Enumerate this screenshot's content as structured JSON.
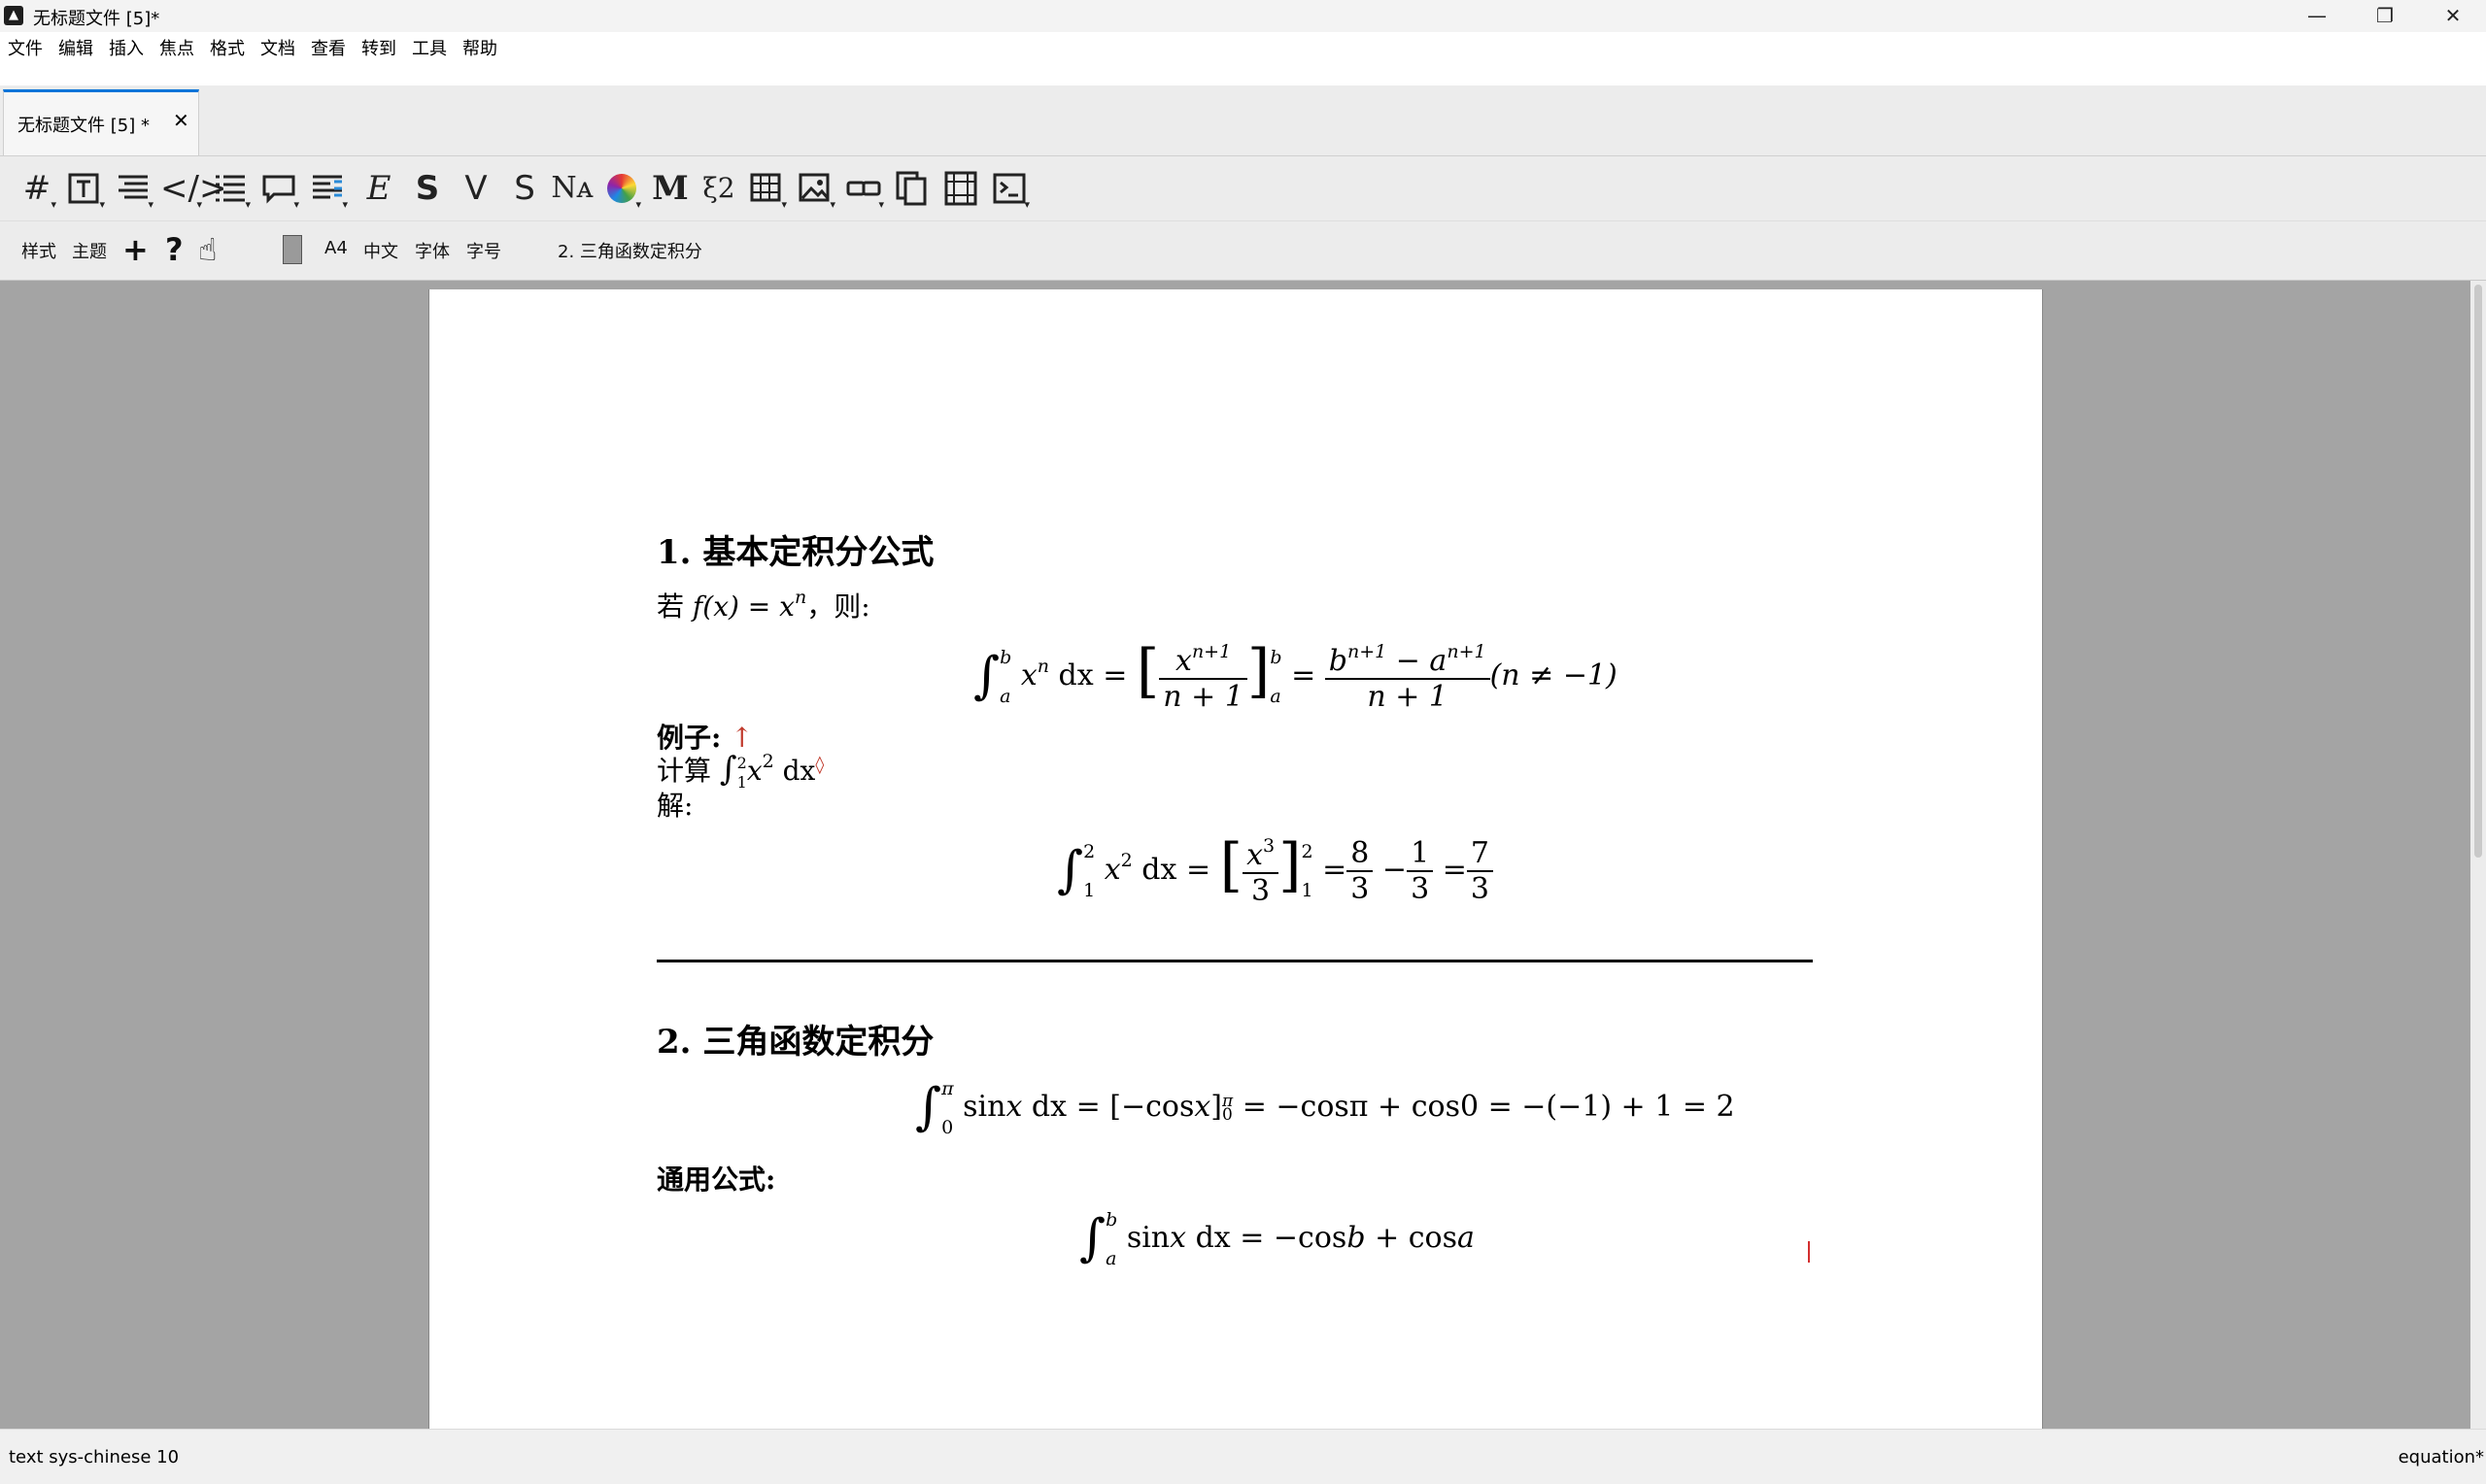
{
  "window": {
    "title": "无标题文件 [5]*",
    "controls": {
      "minimize": "—",
      "restore": "❐",
      "close": "✕"
    }
  },
  "menubar": [
    "文件",
    "编辑",
    "插入",
    "焦点",
    "格式",
    "文档",
    "查看",
    "转到",
    "工具",
    "帮助"
  ],
  "tab": {
    "label": "无标题文件 [5] *",
    "close": "✕"
  },
  "toolbar1": {
    "icons": [
      "section-icon",
      "text-icon",
      "paragraph-icon",
      "code-icon",
      "list-icon",
      "comment-icon",
      "outline-icon",
      "emphasis-icon",
      "strong-icon",
      "verbatim-icon",
      "strike-icon",
      "name-icon",
      "color-icon",
      "math-icon",
      "equation-icon",
      "table-icon",
      "image-icon",
      "link-icon",
      "copy-icon",
      "animation-icon",
      "session-icon"
    ],
    "glyphs": {
      "emphasis": "E",
      "strong": "S",
      "verbatim": "V",
      "strike": "S",
      "name": "Nᴀ",
      "math": "M",
      "equation": "ξ2"
    }
  },
  "toolbar2": {
    "style": "样式",
    "theme": "主题",
    "plus": "+",
    "help": "?",
    "paper": "A4",
    "lang": "中文",
    "font": "字体",
    "size": "字号",
    "section": "2. 三角函数定积分"
  },
  "document": {
    "h1": "1. 基本定积分公式",
    "p1_prefix": "若 ",
    "p1_func": "f(x) = x",
    "p1_exp": "n",
    "p1_suffix": "，则:",
    "eq1": {
      "lower": "a",
      "upper": "b",
      "integrand": "x",
      "integrand_exp": "n",
      "dx": "dx =",
      "frac_num": "x",
      "frac_num_exp": "n+1",
      "frac_den": "n + 1",
      "res_num": "b",
      "res_num_exp": "n+1",
      "res_num_mid": " − a",
      "res_num_exp2": "n+1",
      "res_den": "n + 1",
      "cond": "(n ≠ −1)"
    },
    "example_label": "例子:",
    "calc_label": "计算",
    "calc_expr": {
      "lower": "1",
      "upper": "2",
      "integrand": "x",
      "exp": "2",
      "dx": "dx"
    },
    "solve_label": "解:",
    "eq2": {
      "lower": "1",
      "upper": "2",
      "integrand": "x",
      "exp": "2",
      "dx": "dx =",
      "frac1_num": "x",
      "frac1_num_exp": "3",
      "frac1_den": "3",
      "f2_num": "8",
      "f2_den": "3",
      "f3_num": "1",
      "f3_den": "3",
      "f4_num": "7",
      "f4_den": "3"
    },
    "h2": "2. 三角函数定积分",
    "eq3": {
      "lower": "0",
      "upper": "π",
      "body": "sin",
      "var": "x",
      "rest": " dx = [−cos",
      "rest_var": "x",
      "bracket_sub": "0",
      "bracket_sup": "π",
      "tail": " = −cosπ + cos0 = −(−1) + 1 = 2"
    },
    "general_label": "通用公式:",
    "eq4": {
      "lower": "a",
      "upper": "b",
      "body": "sin",
      "var": "x",
      "rest": " dx = −cos",
      "b": "b",
      "plus": " + cos",
      "a": "a"
    }
  },
  "statusbar": {
    "left": "text sys-chinese 10",
    "right": "equation*"
  }
}
